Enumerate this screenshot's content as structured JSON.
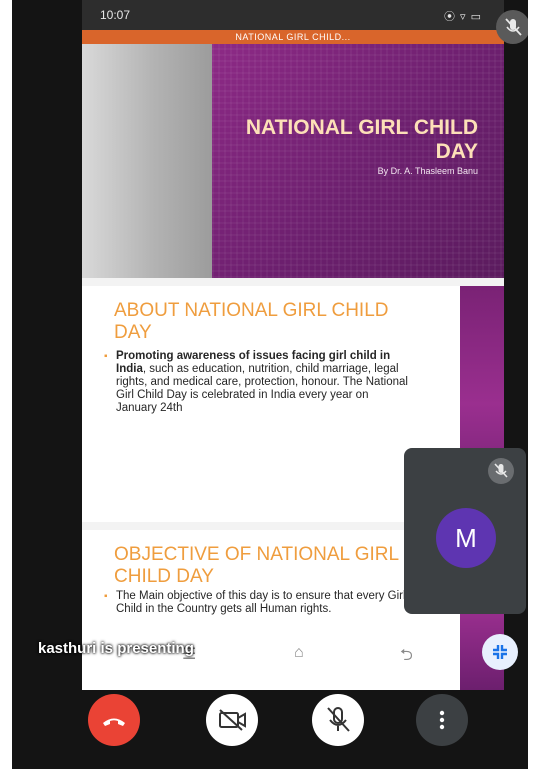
{
  "status_bar": {
    "time": "10:07",
    "right": "⦿ ▿ ▭"
  },
  "document": {
    "title": "NATIONAL GIRL CHILD..."
  },
  "slides": [
    {
      "title": "NATIONAL GIRL CHILD DAY",
      "author": "By Dr. A. Thasleem Banu"
    },
    {
      "heading": "ABOUT NATIONAL GIRL CHILD DAY",
      "body_bold": "Promoting awareness of issues facing girl child in India",
      "body_text": ", such as education, nutrition, child marriage, legal rights, and medical care, protection, honour. The National Girl Child Day is celebrated in India every year on January 24th"
    },
    {
      "heading": "OBJECTIVE OF NATIONAL GIRL CHILD DAY",
      "body_text": "The Main objective of this day is to ensure that every Girl Child in the Country gets all Human rights."
    }
  ],
  "participant": {
    "initial": "M",
    "avatar_color": "#5e35b1"
  },
  "presenting_text": "kasthuri is presenting",
  "colors": {
    "end_call": "#ea4335",
    "slide_accent": "#ef9d3e",
    "slide_purple": "#7a2275"
  },
  "icons": [
    "mic-off-icon",
    "layout-icon",
    "end-call-icon",
    "camera-off-icon",
    "more-options-icon"
  ]
}
